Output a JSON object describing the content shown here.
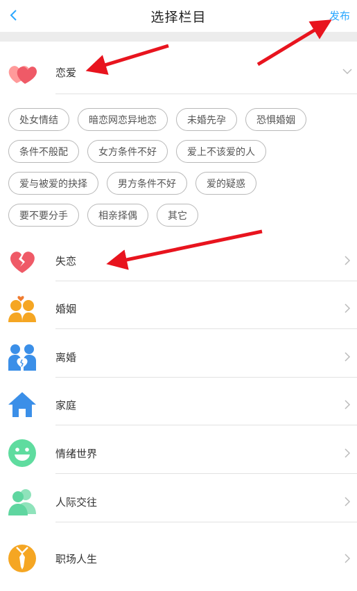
{
  "nav": {
    "back_icon": "chevron-left-icon",
    "title": "选择栏目",
    "publish": "发布"
  },
  "accent": "#2aa7ff",
  "categories": [
    {
      "label": "恋爱",
      "icon": "heart-icon",
      "expanded": true
    },
    {
      "label": "失恋",
      "icon": "broken-heart-icon"
    },
    {
      "label": "婚姻",
      "icon": "couple-icon"
    },
    {
      "label": "离婚",
      "icon": "divorce-couple-icon"
    },
    {
      "label": "家庭",
      "icon": "house-icon"
    },
    {
      "label": "情绪世界",
      "icon": "smiley-icon"
    },
    {
      "label": "人际交往",
      "icon": "people-icon"
    },
    {
      "label": "职场人生",
      "icon": "necktie-icon"
    }
  ],
  "tags": [
    [
      "处女情结",
      "暗恋网恋异地恋",
      "未婚先孕",
      "恐惧婚姻"
    ],
    [
      "条件不般配",
      "女方条件不好",
      "爱上不该爱的人"
    ],
    [
      "爱与被爱的抉择",
      "男方条件不好",
      "爱的疑惑"
    ],
    [
      "要不要分手",
      "相亲择偶",
      "其它"
    ]
  ]
}
